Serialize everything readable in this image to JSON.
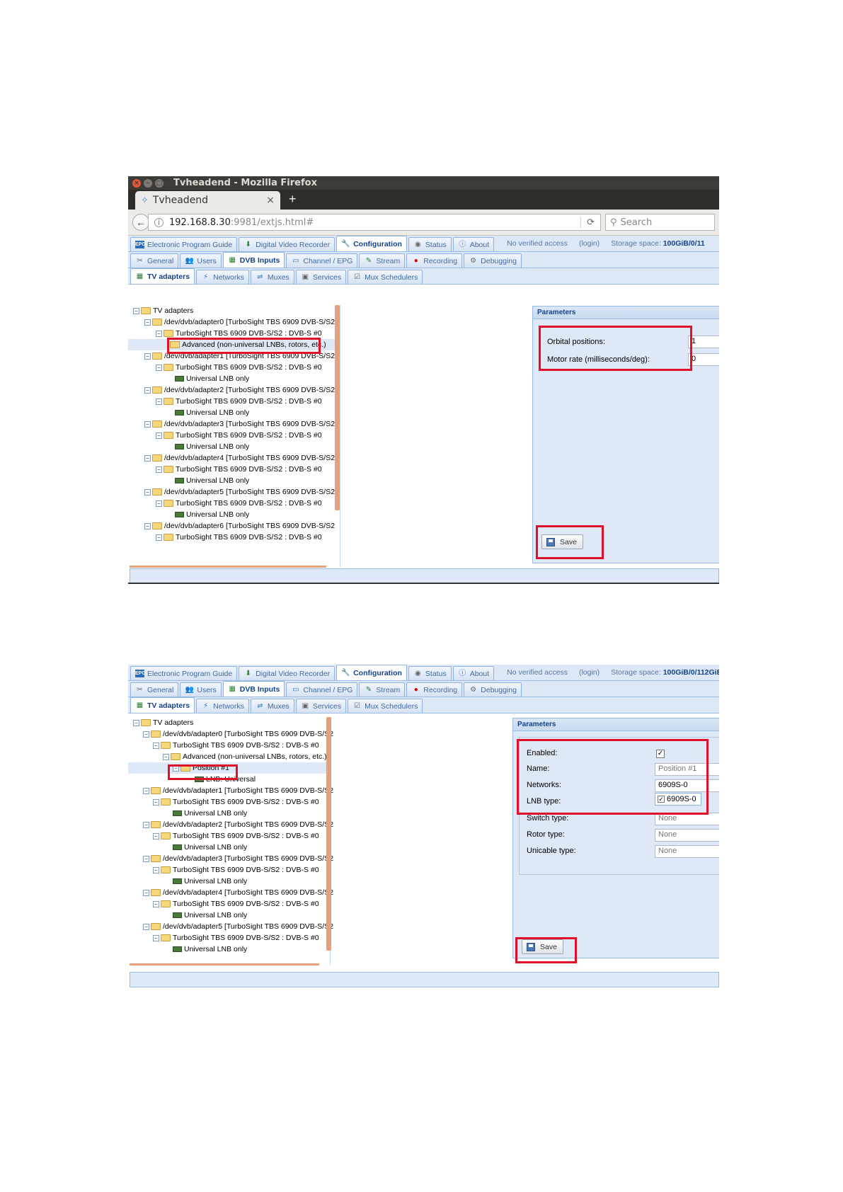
{
  "window": {
    "title": "Tvheadend - Mozilla Firefox",
    "tab_label": "Tvheadend",
    "tab_close": "×",
    "new_tab": "+",
    "url_host": "192.168.8.30",
    "url_path": ":9981/extjs.html#",
    "search_placeholder": "Search"
  },
  "app": {
    "main_tabs": [
      {
        "label": "Electronic Program Guide",
        "icon": "epg-icon"
      },
      {
        "label": "Digital Video Recorder",
        "icon": "dvr-icon"
      },
      {
        "label": "Configuration",
        "icon": "wrench-icon"
      },
      {
        "label": "Status",
        "icon": "eye-icon"
      },
      {
        "label": "About",
        "icon": "info-icon"
      }
    ],
    "access_status": "No verified access",
    "login_link": "(login)",
    "storage_label": "Storage space:",
    "storage_value_1": "100GiB/0/11",
    "storage_value_2": "100GiB/0/112GiB",
    "config_tabs": [
      {
        "label": "General"
      },
      {
        "label": "Users"
      },
      {
        "label": "DVB Inputs"
      },
      {
        "label": "Channel / EPG"
      },
      {
        "label": "Stream"
      },
      {
        "label": "Recording"
      },
      {
        "label": "Debugging"
      }
    ],
    "dvb_tabs": [
      {
        "label": "TV adapters"
      },
      {
        "label": "Networks"
      },
      {
        "label": "Muxes"
      },
      {
        "label": "Services"
      },
      {
        "label": "Mux Schedulers"
      }
    ]
  },
  "shot1": {
    "tree": [
      {
        "label": "TV adapters"
      },
      {
        "label": "/dev/dvb/adapter0 [TurboSight TBS 6909 DVB-S/S2"
      },
      {
        "label": "TurboSight TBS 6909 DVB-S/S2 : DVB-S #0"
      },
      {
        "label": "Advanced (non-universal LNBs, rotors, etc.)"
      },
      {
        "label": "/dev/dvb/adapter1 [TurboSight TBS 6909 DVB-S/S2"
      },
      {
        "label": "TurboSight TBS 6909 DVB-S/S2 : DVB-S #0"
      },
      {
        "label": "Universal LNB only"
      },
      {
        "label": "/dev/dvb/adapter2 [TurboSight TBS 6909 DVB-S/S2"
      },
      {
        "label": "TurboSight TBS 6909 DVB-S/S2 : DVB-S #0"
      },
      {
        "label": "Universal LNB only"
      },
      {
        "label": "/dev/dvb/adapter3 [TurboSight TBS 6909 DVB-S/S2"
      },
      {
        "label": "TurboSight TBS 6909 DVB-S/S2 : DVB-S #0"
      },
      {
        "label": "Universal LNB only"
      },
      {
        "label": "/dev/dvb/adapter4 [TurboSight TBS 6909 DVB-S/S2"
      },
      {
        "label": "TurboSight TBS 6909 DVB-S/S2 : DVB-S #0"
      },
      {
        "label": "Universal LNB only"
      },
      {
        "label": "/dev/dvb/adapter5 [TurboSight TBS 6909 DVB-S/S2"
      },
      {
        "label": "TurboSight TBS 6909 DVB-S/S2 : DVB-S #0"
      },
      {
        "label": "Universal LNB only"
      },
      {
        "label": "/dev/dvb/adapter6 [TurboSight TBS 6909 DVB-S/S2"
      },
      {
        "label": "TurboSight TBS 6909 DVB-S/S2 : DVB-S #0"
      }
    ],
    "params_title": "Parameters",
    "orbital_label": "Orbital positions:",
    "orbital_value": "1",
    "motor_label": "Motor rate (milliseconds/deg):",
    "motor_value": "0",
    "save_label": "Save"
  },
  "shot2": {
    "tree": [
      {
        "label": "TV adapters"
      },
      {
        "label": "/dev/dvb/adapter0 [TurboSight TBS 6909 DVB-S/S2"
      },
      {
        "label": "TurboSight TBS 6909 DVB-S/S2 : DVB-S #0"
      },
      {
        "label": "Advanced (non-universal LNBs, rotors, etc.)"
      },
      {
        "label": "Position #1"
      },
      {
        "label": "LNB: Universal"
      },
      {
        "label": "/dev/dvb/adapter1 [TurboSight TBS 6909 DVB-S/S2"
      },
      {
        "label": "TurboSight TBS 6909 DVB-S/S2 : DVB-S #0"
      },
      {
        "label": "Universal LNB only"
      },
      {
        "label": "/dev/dvb/adapter2 [TurboSight TBS 6909 DVB-S/S2"
      },
      {
        "label": "TurboSight TBS 6909 DVB-S/S2 : DVB-S #0"
      },
      {
        "label": "Universal LNB only"
      },
      {
        "label": "/dev/dvb/adapter3 [TurboSight TBS 6909 DVB-S/S2"
      },
      {
        "label": "TurboSight TBS 6909 DVB-S/S2 : DVB-S #0"
      },
      {
        "label": "Universal LNB only"
      },
      {
        "label": "/dev/dvb/adapter4 [TurboSight TBS 6909 DVB-S/S2"
      },
      {
        "label": "TurboSight TBS 6909 DVB-S/S2 : DVB-S #0"
      },
      {
        "label": "Universal LNB only"
      },
      {
        "label": "/dev/dvb/adapter5 [TurboSight TBS 6909 DVB-S/S2"
      },
      {
        "label": "TurboSight TBS 6909 DVB-S/S2 : DVB-S #0"
      },
      {
        "label": "Universal LNB only"
      }
    ],
    "params_title": "Parameters",
    "enabled_label": "Enabled:",
    "enabled_check": "✓",
    "name_label": "Name:",
    "name_value": "Position #1",
    "networks_label": "Networks:",
    "networks_value": "6909S-0",
    "networks_option": "6909S-0",
    "lnb_label": "LNB type:",
    "switch_label": "Switch type:",
    "switch_value": "None",
    "rotor_label": "Rotor type:",
    "rotor_value": "None",
    "unicable_label": "Unicable type:",
    "unicable_value": "None",
    "save_label": "Save"
  },
  "colors": {
    "highlight_box": "#e0102a",
    "ext_blue": "#15428b",
    "panel_bg": "#dfe8f6"
  }
}
